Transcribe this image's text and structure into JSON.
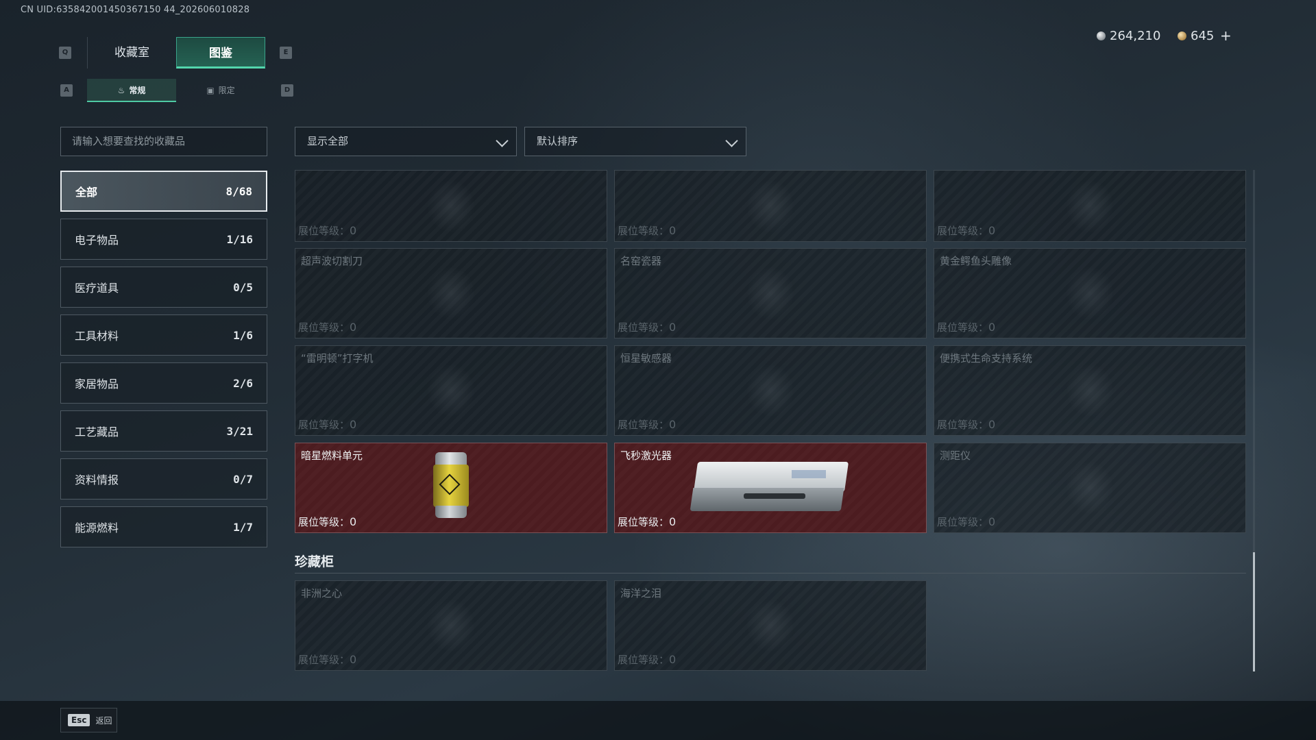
{
  "uid": "CN UID:635842001450367150 44_202606010828",
  "keys": {
    "q": "Q",
    "e": "E",
    "a": "A",
    "d": "D"
  },
  "tabs": {
    "main": [
      "收藏室",
      "图鉴"
    ],
    "sub": [
      "常规",
      "限定"
    ]
  },
  "currency": {
    "silver": "264,210",
    "gold": "645",
    "add": "+"
  },
  "search": {
    "placeholder": "请输入想要查找的收藏品"
  },
  "categories": [
    {
      "label": "全部",
      "count": "8/68"
    },
    {
      "label": "电子物品",
      "count": "1/16"
    },
    {
      "label": "医疗道具",
      "count": "0/5"
    },
    {
      "label": "工具材料",
      "count": "1/6"
    },
    {
      "label": "家居物品",
      "count": "2/6"
    },
    {
      "label": "工艺藏品",
      "count": "3/21"
    },
    {
      "label": "资料情报",
      "count": "0/7"
    },
    {
      "label": "能源燃料",
      "count": "1/7"
    }
  ],
  "filters": {
    "show": "显示全部",
    "sort": "默认排序"
  },
  "level_label": "展位等级：",
  "items": [
    {
      "name": "",
      "level": "0",
      "owned": false
    },
    {
      "name": "",
      "level": "0",
      "owned": false
    },
    {
      "name": "",
      "level": "0",
      "owned": false
    },
    {
      "name": "超声波切割刀",
      "level": "0",
      "owned": false
    },
    {
      "name": "名窑瓷器",
      "level": "0",
      "owned": false
    },
    {
      "name": "黄金鳄鱼头雕像",
      "level": "0",
      "owned": false
    },
    {
      "name": "“雷明顿”打字机",
      "level": "0",
      "owned": false
    },
    {
      "name": "恒星敏感器",
      "level": "0",
      "owned": false
    },
    {
      "name": "便携式生命支持系统",
      "level": "0",
      "owned": false
    },
    {
      "name": "暗星燃料单元",
      "level": "0",
      "owned": true
    },
    {
      "name": "飞秒激光器",
      "level": "0",
      "owned": true
    },
    {
      "name": "测距仪",
      "level": "0",
      "owned": false
    }
  ],
  "cabinet": {
    "title": "珍藏柜",
    "items": [
      {
        "name": "非洲之心",
        "level": "0"
      },
      {
        "name": "海洋之泪",
        "level": "0"
      }
    ]
  },
  "footer": {
    "esc_key": "Esc",
    "esc_label": "返回"
  },
  "colors": {
    "accent": "#53d6ad",
    "owned_bg": "#4c1c20",
    "active_tab": "#256253"
  }
}
